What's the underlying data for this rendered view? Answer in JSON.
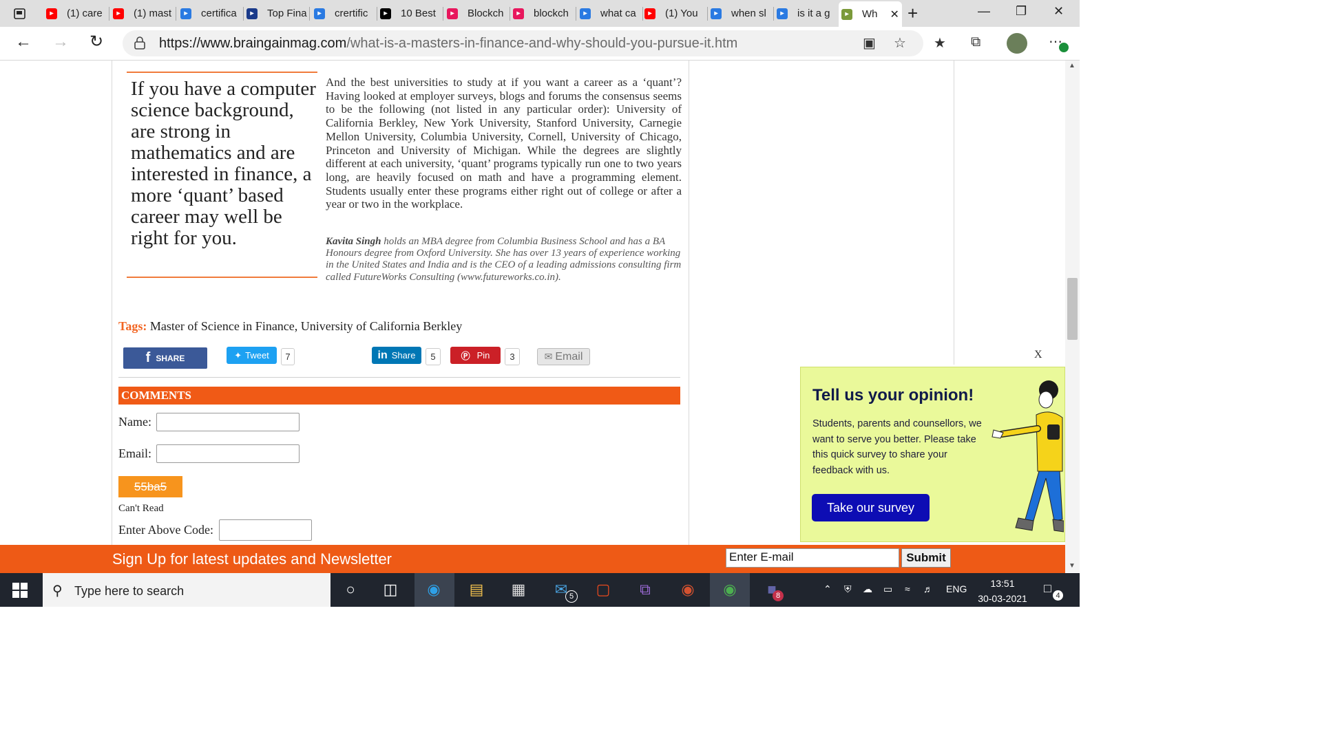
{
  "browser": {
    "tabs": [
      {
        "label": "(1) care",
        "icon": "youtube-icon",
        "color": "#ff0000"
      },
      {
        "label": "(1) mast",
        "icon": "youtube-icon",
        "color": "#ff0000"
      },
      {
        "label": "certifica",
        "icon": "bing-icon",
        "color": "#2a7ae2"
      },
      {
        "label": "Top Fina",
        "icon": "wall-street-icon",
        "color": "#1a3a8a"
      },
      {
        "label": "crertific",
        "icon": "bing-icon",
        "color": "#2a7ae2"
      },
      {
        "label": "10 Best",
        "icon": "medium-icon",
        "color": "#000000"
      },
      {
        "label": "Blockch",
        "icon": "play-circle-icon",
        "color": "#e8175d"
      },
      {
        "label": "blockch",
        "icon": "play-circle-icon",
        "color": "#e8175d"
      },
      {
        "label": "what ca",
        "icon": "bing-icon",
        "color": "#2a7ae2"
      },
      {
        "label": "(1) You",
        "icon": "youtube-icon",
        "color": "#ff0000"
      },
      {
        "label": "when sl",
        "icon": "bing-icon",
        "color": "#2a7ae2"
      },
      {
        "label": "is it a g",
        "icon": "bing-icon",
        "color": "#2a7ae2"
      },
      {
        "label": "Wh",
        "icon": "braingain-icon",
        "color": "#7b9a3a",
        "active": true
      }
    ],
    "url_host": "https://www.braingainmag.com",
    "url_path": "/what-is-a-masters-in-finance-and-why-should-you-pursue-it.htm"
  },
  "article": {
    "pullquote": "If you have a computer science background, are strong in mathematics and are interested in finance, a more ‘quant’ based career may well be right for you.",
    "paragraph": "And the best universities to study at if you want a career as a ‘quant’? Having looked at employer surveys, blogs and forums the consensus seems to be the following (not listed in any particular order): University of California Berkley, New York University, Stanford University, Carnegie Mellon University, Columbia University, Cornell, University of Chicago, Princeton and University of Michigan. While the degrees are slightly different at each university, ‘quant’ programs typically run one to two years long, are heavily focused on math and have a programming element. Students usually enter these programs either right out of college or after a year or two in the workplace.",
    "bio_name": "Kavita Singh",
    "bio_text": " holds an MBA degree from Columbia Business School and has a BA Honours degree from Oxford University. She has over 13 years of experience working in the United States and India and is the CEO of a leading admissions consulting firm called FutureWorks Consulting (www.futureworks.co.in).",
    "tags_label": "Tags:",
    "tag1": "Master of Science in Finance",
    "tag_sep": ", ",
    "tag2": "University of California Berkley"
  },
  "share": {
    "facebook": "SHARE",
    "twitter": "Tweet",
    "twitter_count": "7",
    "linkedin": "Share",
    "linkedin_count": "5",
    "pinterest": "Pin",
    "pinterest_count": "3",
    "email": "Email"
  },
  "comments": {
    "header": "COMMENTS",
    "name_label": "Name:",
    "email_label": "Email:",
    "captcha": "55ba5",
    "cant_read": "Can't Read",
    "code_label": "Enter Above Code:"
  },
  "survey": {
    "close": "X",
    "title": "Tell us your opinion!",
    "body": "Students, parents and counsellors, we want to serve you better. Please take this quick survey to share your feedback with us.",
    "button": "Take our survey"
  },
  "newsletter": {
    "text": "Sign Up for latest updates and Newsletter",
    "email_value": "Enter E-mail",
    "submit": "Submit"
  },
  "taskbar": {
    "search_placeholder": "Type here to search",
    "mail_badge": "5",
    "teams_badge": "8",
    "language": "ENG",
    "time": "13:51",
    "date": "30-03-2021",
    "notifications": "4"
  },
  "colors": {
    "accent_orange": "#f05a16",
    "facebook": "#3b5998",
    "twitter": "#1da1f2",
    "linkedin": "#0077b5",
    "pinterest": "#cb2027",
    "survey_bg": "#eaf99a",
    "survey_button": "#0d0db4"
  }
}
